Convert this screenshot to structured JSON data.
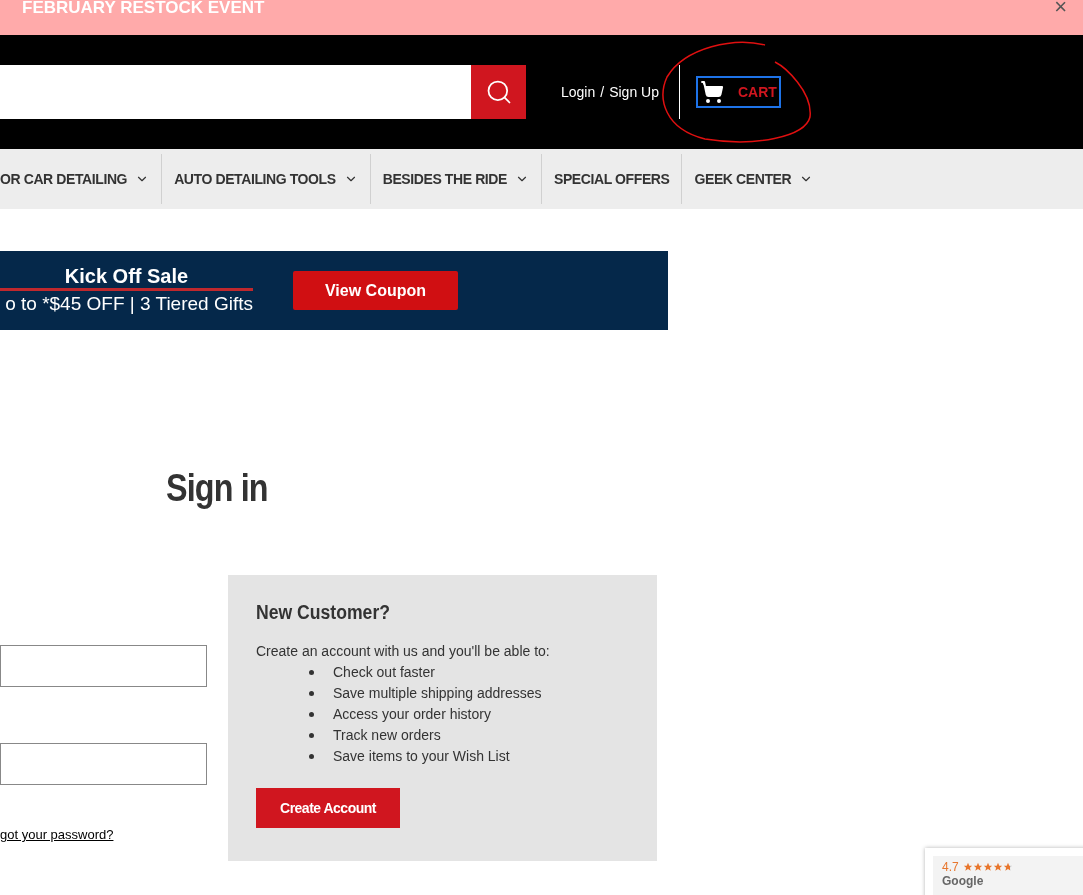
{
  "announcement": {
    "text": "FEBRUARY RESTOCK EVENT",
    "close": "×"
  },
  "header": {
    "login": "Login",
    "separator": "/",
    "signup": "Sign Up",
    "cart": "CART",
    "annotated": true
  },
  "nav": [
    {
      "label": "OR CAR DETAILING",
      "dropdown": true
    },
    {
      "label": "AUTO DETAILING TOOLS",
      "dropdown": true
    },
    {
      "label": "BESIDES THE RIDE",
      "dropdown": true
    },
    {
      "label": "SPECIAL OFFERS",
      "dropdown": false
    },
    {
      "label": "GEEK CENTER",
      "dropdown": true
    }
  ],
  "promo": {
    "title": "Kick Off Sale",
    "subtitle": "o to *$45 OFF | 3 Tiered Gifts",
    "button": "View Coupon"
  },
  "signin": {
    "title": "Sign in",
    "forgot": "got your password?"
  },
  "new_customer": {
    "title": "New Customer?",
    "intro": "Create an account with us and you'll be able to:",
    "benefits": [
      "Check out faster",
      "Save multiple shipping addresses",
      "Access your order history",
      "Track new orders",
      "Save items to your Wish List"
    ],
    "button": "Create Account"
  },
  "rating_badge": {
    "score": "4.7",
    "stars": 4.7,
    "brand": "Google"
  }
}
